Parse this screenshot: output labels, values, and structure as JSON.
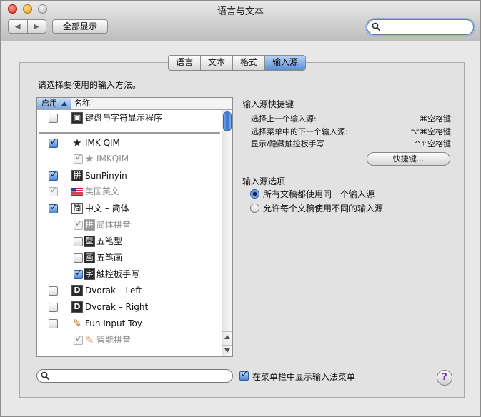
{
  "window": {
    "title": "语言与文本"
  },
  "toolbar": {
    "back_icon": "◀",
    "forward_icon": "▶",
    "show_all_label": "全部显示",
    "search_value": ""
  },
  "tabs": [
    {
      "label": "语言",
      "active": false
    },
    {
      "label": "文本",
      "active": false
    },
    {
      "label": "格式",
      "active": false
    },
    {
      "label": "输入源",
      "active": true
    }
  ],
  "instruction": "请选择要使用的输入方法。",
  "list": {
    "header_enabled": "启用",
    "header_name": "名称",
    "items": [
      {
        "label": "键盘与字符显示程序",
        "checked": false,
        "dim": false,
        "icon": "keyboard-viewer-icon",
        "glyph": "▣"
      },
      {
        "label": "IMK QIM",
        "checked": true,
        "dim": false,
        "icon": "star-icon",
        "glyph": "★"
      },
      {
        "label": "IMKQIM",
        "checked": true,
        "dim": true,
        "icon": "star-icon",
        "glyph": "★"
      },
      {
        "label": "SunPinyin",
        "checked": true,
        "dim": false,
        "icon": "pinyin-icon",
        "glyph": "拼"
      },
      {
        "label": "美国英文",
        "checked": true,
        "dim": true,
        "icon": "us-flag-icon",
        "glyph": ""
      },
      {
        "label": "中文 – 简体",
        "checked": true,
        "dim": false,
        "icon": "simplified-chinese-icon",
        "glyph": "简"
      },
      {
        "label": "简体拼音",
        "checked": true,
        "dim": true,
        "icon": "pinyin-icon",
        "glyph": "拼"
      },
      {
        "label": "五笔型",
        "checked": false,
        "dim": false,
        "icon": "wubi-icon",
        "glyph": "型"
      },
      {
        "label": "五笔画",
        "checked": false,
        "dim": false,
        "icon": "wubihua-icon",
        "glyph": "画"
      },
      {
        "label": "触控板手写",
        "checked": true,
        "dim": false,
        "icon": "handwriting-icon",
        "glyph": "字"
      },
      {
        "label": "Dvorak – Left",
        "checked": false,
        "dim": false,
        "icon": "dvorak-icon",
        "glyph": "D"
      },
      {
        "label": "Dvorak – Right",
        "checked": false,
        "dim": false,
        "icon": "dvorak-icon",
        "glyph": "D"
      },
      {
        "label": "Fun Input Toy",
        "checked": false,
        "dim": false,
        "icon": "pen-icon",
        "glyph": "✎"
      },
      {
        "label": "智能拼音",
        "checked": true,
        "dim": true,
        "icon": "pen-icon",
        "glyph": "✎"
      }
    ]
  },
  "shortcuts": {
    "title": "输入源快捷键",
    "rows": [
      {
        "label": "选择上一个输入源:",
        "keys": "⌘空格键"
      },
      {
        "label": "选择菜单中的下一个输入源:",
        "keys": "⌥⌘空格键"
      },
      {
        "label": "显示/隐藏触控板手写",
        "keys": "^⇧空格键"
      }
    ],
    "button_label": "快捷键..."
  },
  "options": {
    "title": "输入源选项",
    "radios": [
      {
        "label": "所有文稿都使用同一个输入源",
        "selected": true
      },
      {
        "label": "允许每个文稿使用不同的输入源",
        "selected": false
      }
    ]
  },
  "bottom": {
    "search_value": "",
    "menubar_label": "在菜单栏中显示输入法菜单",
    "menubar_checked": true,
    "help_label": "?"
  }
}
